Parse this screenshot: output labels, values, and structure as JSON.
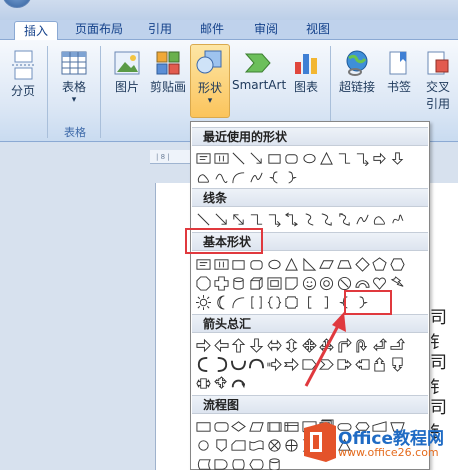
{
  "tabs": {
    "insert": "插入",
    "page_layout": "页面布局",
    "references": "引用",
    "mailings": "邮件",
    "review": "审阅",
    "view": "视图"
  },
  "ribbon": {
    "page_break": "分页",
    "table": "表格",
    "table_group": "表格",
    "picture": "图片",
    "clip_art": "剪贴画",
    "shapes": "形状",
    "smartart": "SmartArt",
    "chart": "图表",
    "hyperlink": "超链接",
    "bookmark": "书签",
    "cross_ref_line1": "交叉",
    "cross_ref_line2": "引用",
    "dropdown_marker": "▾"
  },
  "ruler_text": "| 8 |",
  "shapes_menu": {
    "recent": "最近使用的形状",
    "lines": "线条",
    "basic": "基本形状",
    "arrows": "箭头总汇",
    "flowchart": "流程图"
  },
  "document": {
    "frag": "司钅"
  },
  "watermark": {
    "brand": "Office教程网",
    "url": "www.office26.com"
  },
  "colors": {
    "highlight": "#e0393e",
    "ribbon_text": "#15428b",
    "shape_button": "#fbc45c"
  }
}
